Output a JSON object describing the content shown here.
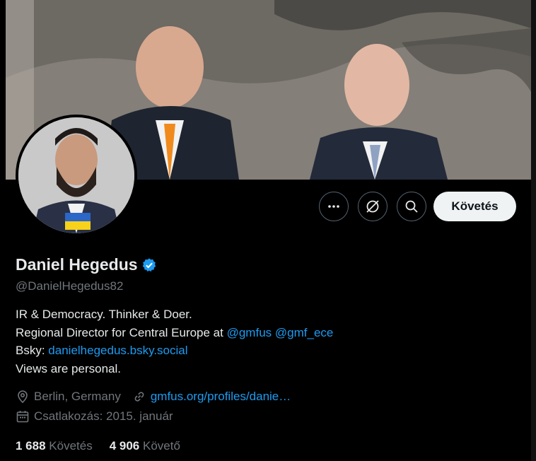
{
  "profile": {
    "name": "Daniel Hegedus",
    "handle": "@DanielHegedus82",
    "bio_line1": "IR & Democracy. Thinker & Doer.",
    "bio_line2_text": "Regional Director for Central Europe at ",
    "bio_mention1": "@gmfus",
    "bio_mention2": "@gmf_ece",
    "bio_line3_text": "Bsky: ",
    "bio_link": "danielhegedus.bsky.social",
    "bio_line4": "Views are personal.",
    "location": "Berlin, Germany",
    "website": "gmfus.org/profiles/danie…",
    "joined": "Csatlakozás: 2015. január"
  },
  "actions": {
    "more_icon": "more-icon",
    "grok_icon": "grok-icon",
    "search_icon": "search-icon",
    "follow_label": "Követés"
  },
  "stats": {
    "following_count": "1 688",
    "following_label": "Követés",
    "followers_count": "4 906",
    "followers_label": "Követő"
  },
  "colors": {
    "background": "#000000",
    "text": "#e7e9ea",
    "muted": "#71767b",
    "link": "#1d9bf0",
    "button_bg": "#eff3f4"
  }
}
